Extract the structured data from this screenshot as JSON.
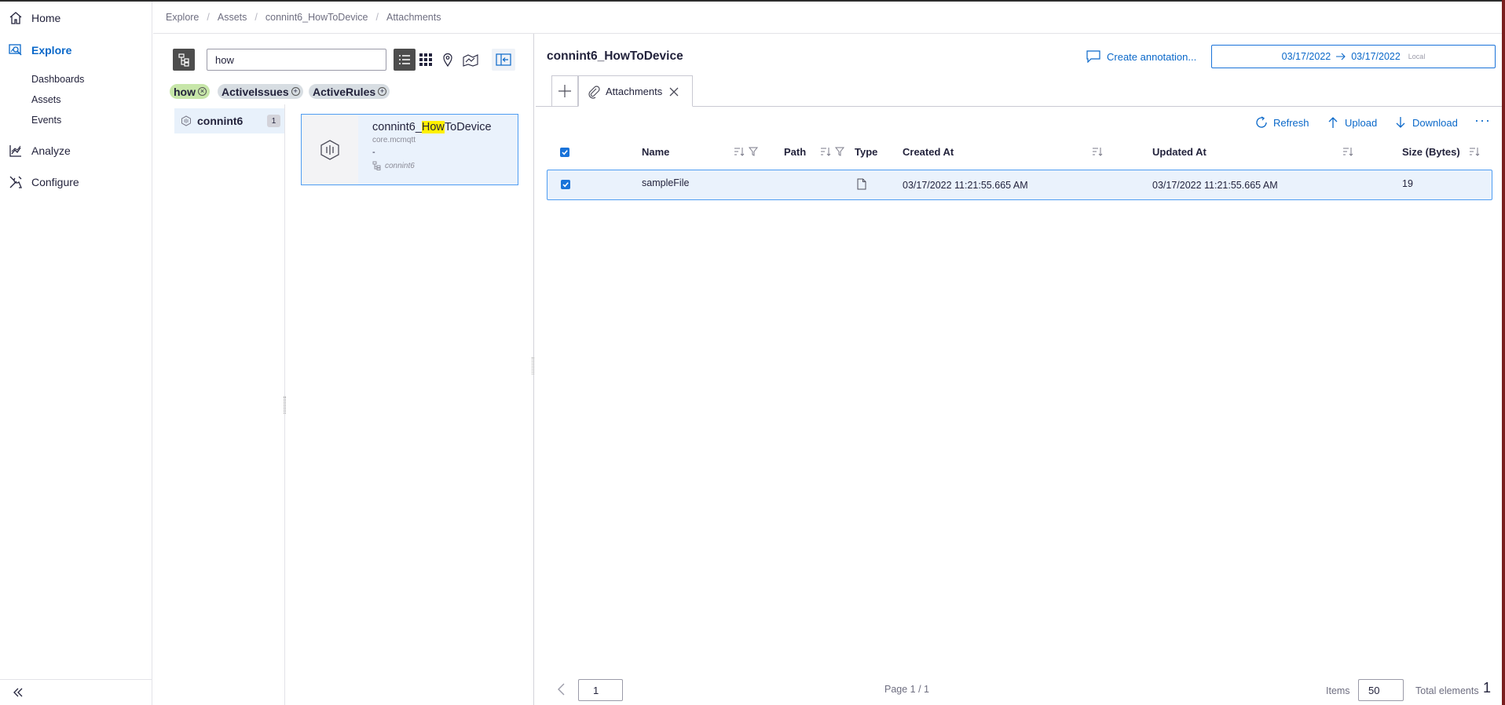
{
  "nav": {
    "home": "Home",
    "explore": "Explore",
    "dashboards": "Dashboards",
    "assets": "Assets",
    "events": "Events",
    "analyze": "Analyze",
    "configure": "Configure"
  },
  "breadcrumb": [
    "Explore",
    "Assets",
    "connint6_HowToDevice",
    "Attachments"
  ],
  "search": {
    "value": "how"
  },
  "filters": [
    {
      "label": "how",
      "active": true
    },
    {
      "label": "ActiveIssues",
      "active": false
    },
    {
      "label": "ActiveRules",
      "active": false
    }
  ],
  "tree": {
    "node_label": "connint6",
    "node_count": "1"
  },
  "asset_card": {
    "name_prefix": "connint6_",
    "name_highlight": "How",
    "name_suffix": "ToDevice",
    "type": "core.mcmqtt",
    "description": "-",
    "parent": "connint6"
  },
  "detail": {
    "title": "connint6_HowToDevice",
    "create_annotation": "Create annotation...",
    "date_from": "03/17/2022",
    "date_to": "03/17/2022",
    "timezone": "Local",
    "tab_label": "Attachments"
  },
  "toolbar": {
    "refresh": "Refresh",
    "upload": "Upload",
    "download": "Download"
  },
  "table": {
    "headers": [
      "Name",
      "Path",
      "Type",
      "Created At",
      "Updated At",
      "Size (Bytes)"
    ],
    "rows": [
      {
        "name": "sampleFile",
        "path": "",
        "type": "file",
        "created": "03/17/2022 11:21:55.665 AM",
        "updated": "03/17/2022 11:21:55.665 AM",
        "size": "19"
      }
    ]
  },
  "pagination": {
    "page_value": "1",
    "page_info": "Page 1 / 1",
    "items_label": "Items",
    "items_value": "50",
    "total_label": "Total elements",
    "total_value": "1"
  },
  "colors": {
    "accent": "#0a68c9",
    "selection_bg": "#eaf2fc",
    "filter_active": "#c7e6a9",
    "highlight": "#fff000"
  }
}
